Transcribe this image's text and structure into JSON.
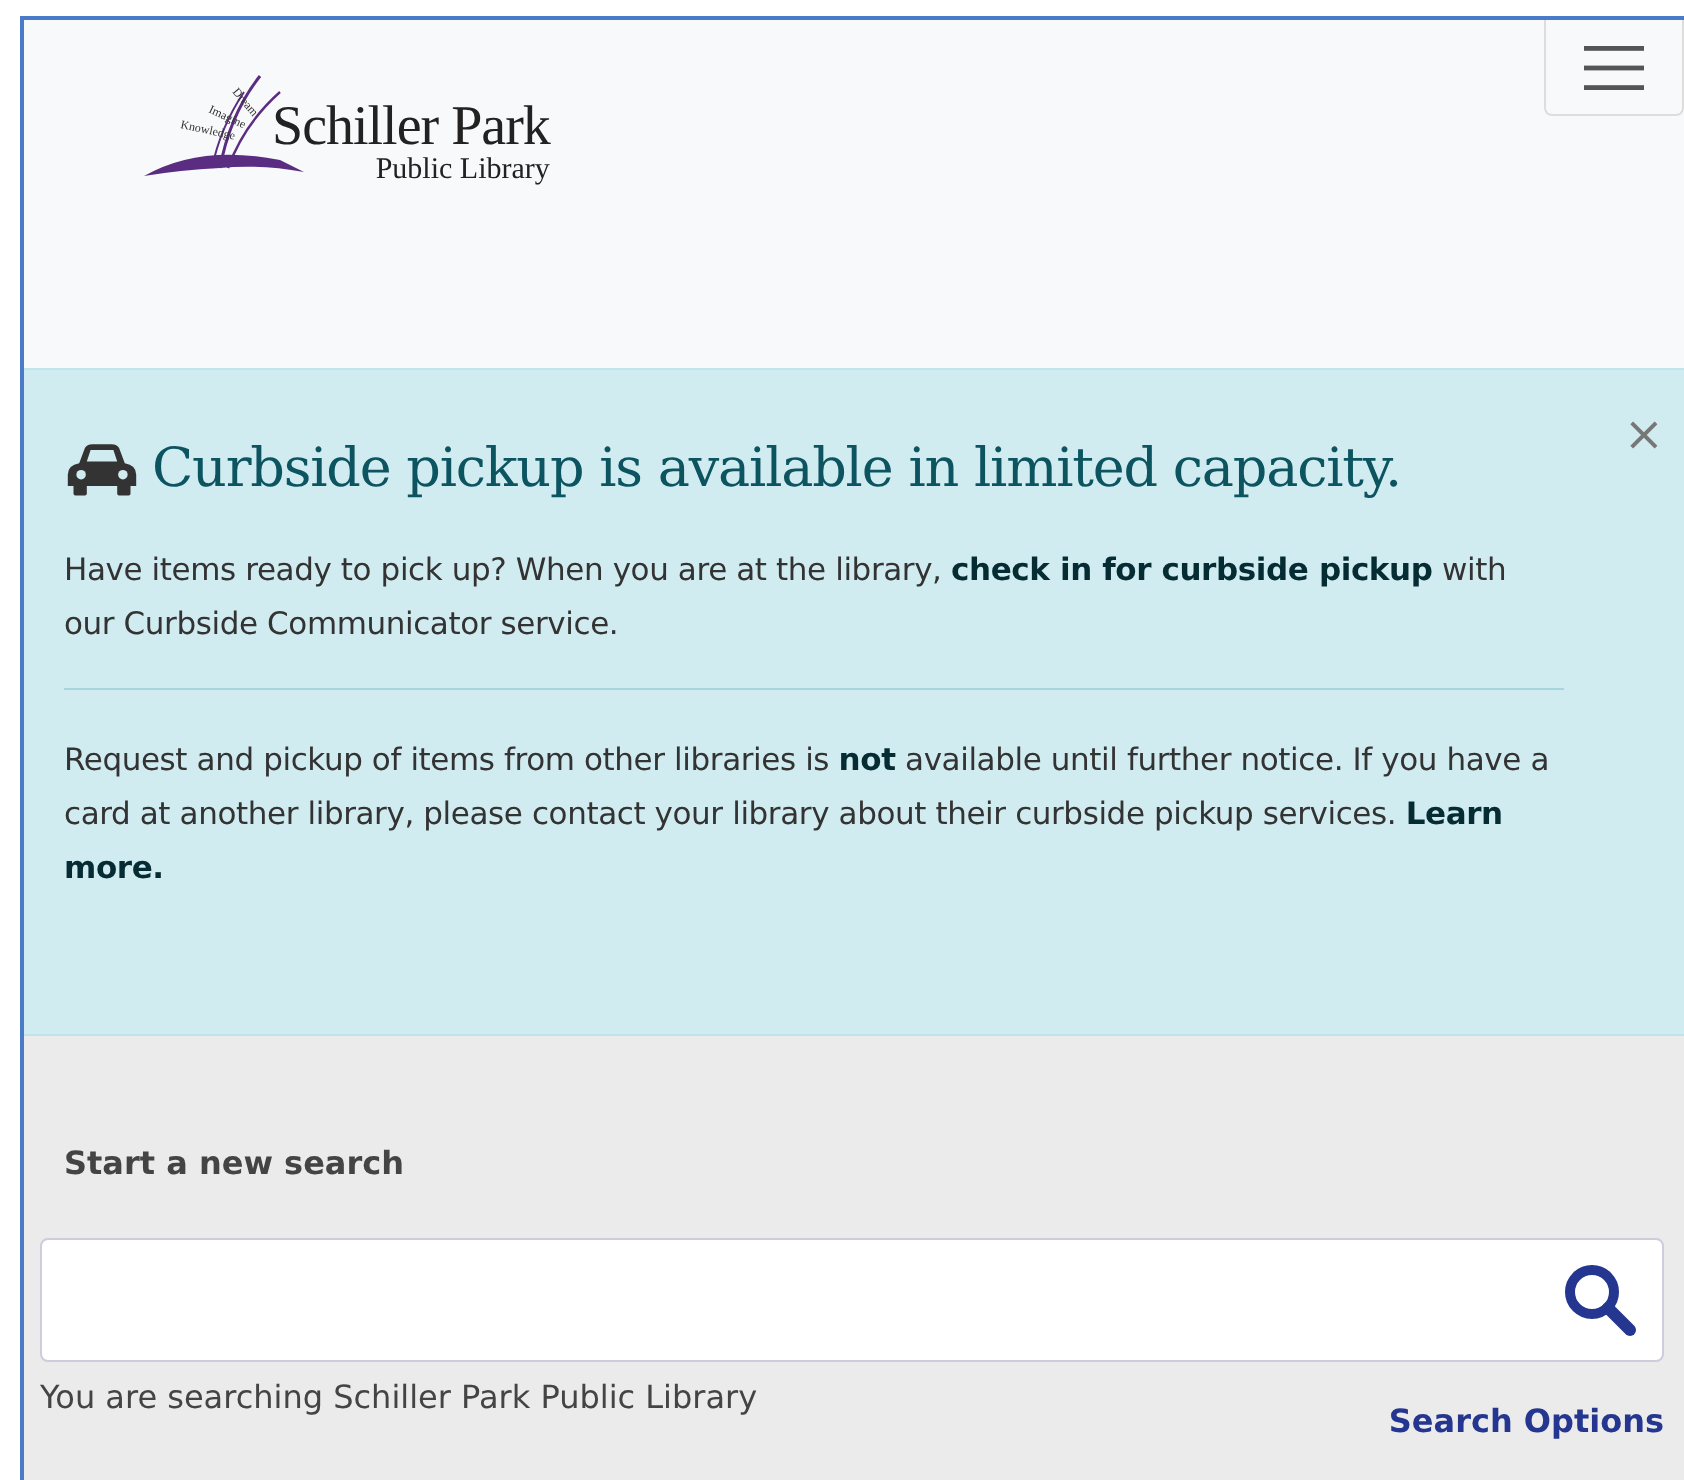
{
  "logo": {
    "tagline_words": [
      "Dream",
      "Imagine",
      "Knowledge"
    ],
    "name": "Schiller Park",
    "subtitle": "Public Library"
  },
  "alert": {
    "close": "×",
    "heading": "Curbside pickup is available in limited capacity.",
    "paragraphs": [
      "Have items ready to pick up? When you are at the library, **check in for curbside pickup** with our Curbside Communicator service.",
      "Request and pickup of items from other libraries is **not** available until further notice. If you have a card at another library, please contact your library about their curbside pickup services. **Learn more.**"
    ]
  },
  "search": {
    "label": "Start a new search",
    "scope": "You are searching Schiller Park Public Library",
    "options_link": "Search Options"
  }
}
